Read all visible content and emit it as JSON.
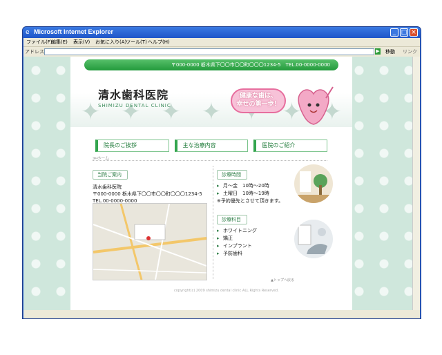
{
  "window": {
    "title": "Microsoft Internet Explorer"
  },
  "menu": [
    "ファイル(F)",
    "編集(E)",
    "表示(V)",
    "お気に入り(A)",
    "ツール(T)",
    "ヘルプ(H)"
  ],
  "address_bar": {
    "label": "アドレス(D)",
    "value": "",
    "go_label": "移動",
    "links_label": "リンク"
  },
  "site": {
    "top_address": "〒000-0000 栃木県下〇〇市〇〇町〇〇〇1234-5　TEL.00-0000-0000",
    "logo_jp": "清水歯科医院",
    "logo_en": "SHIMIZU DENTAL CLINIC",
    "bubble_line1": "健康な歯は、",
    "bubble_line2": "幸せの第一歩！",
    "nav": [
      "院長のご挨拶",
      "主な治療内容",
      "医院のご紹介"
    ],
    "breadcrumb": "≫ホーム",
    "access": {
      "heading": "当院ご案内",
      "name": "清水歯科医院",
      "address": "〒000-0000 栃木県下〇〇市〇〇町〇〇〇1234-5",
      "tel": "TEL.00-0000-0000"
    },
    "hours": {
      "heading": "診療時間",
      "rows": [
        "月～金　10時～20時",
        "土曜日　10時～19時"
      ],
      "note": "※予約優先とさせて頂きます。"
    },
    "services": {
      "heading": "診療科目",
      "items": [
        "ホワイトニング",
        "矯正",
        "インプラント",
        "予防歯科"
      ]
    },
    "to_top": "▲トップへ戻る",
    "copyright": "copyright(c) 2009 shimizu dental clinic ALL Rights Reserved."
  },
  "colors": {
    "brand_green": "#239a3c",
    "accent_pink": "#e76e9e",
    "bg_mint": "#cfe7dc"
  }
}
